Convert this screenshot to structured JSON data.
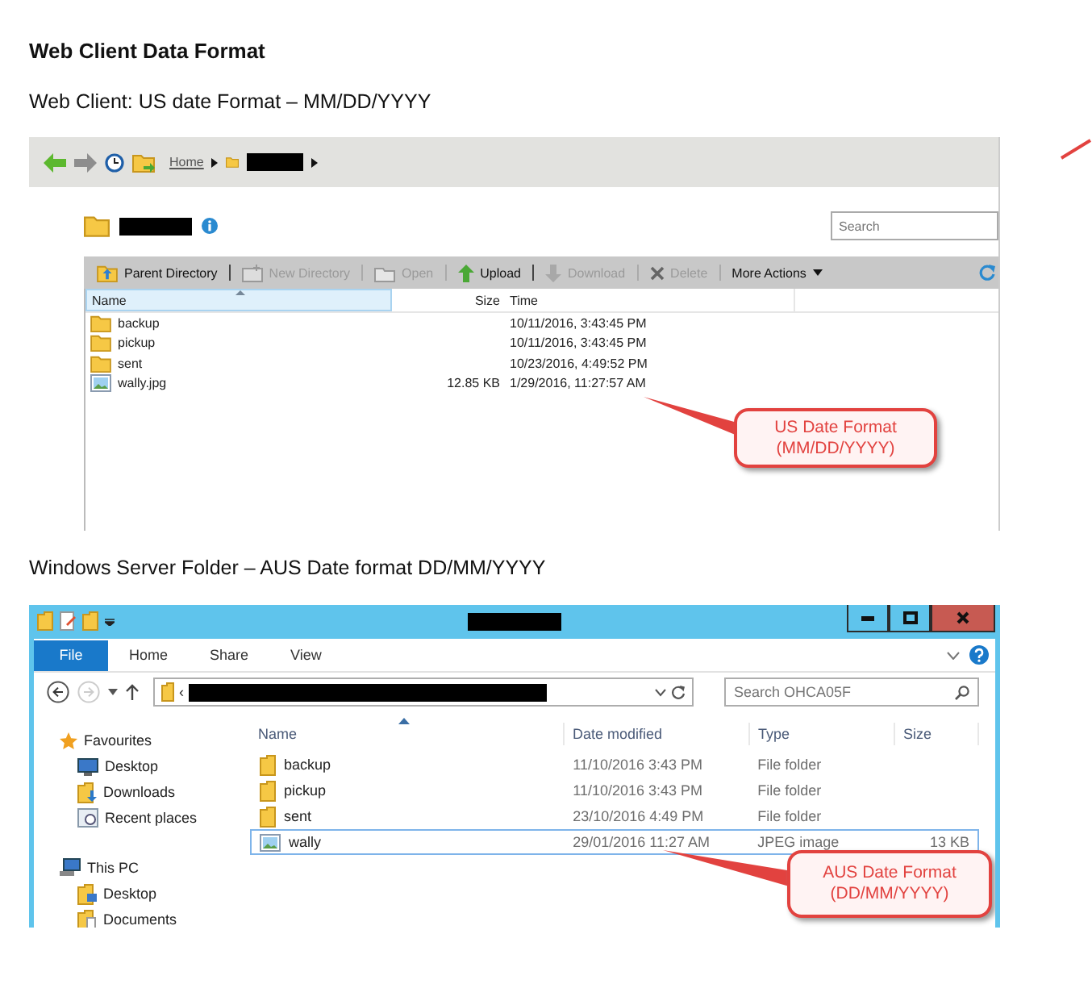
{
  "heading": "Web Client Data Format",
  "web_client_caption": "Web Client: US date Format – MM/DD/YYYY",
  "web_client": {
    "breadcrumb_home": "Home",
    "search": {
      "placeholder": "Search"
    },
    "toolbar": [
      {
        "label": "Parent Directory",
        "kind": "button",
        "disabled": false
      },
      {
        "label": "New Directory",
        "kind": "button",
        "disabled": true
      },
      {
        "label": "Open",
        "kind": "button",
        "disabled": true
      },
      {
        "label": "Upload",
        "kind": "button",
        "disabled": false
      },
      {
        "label": "Download",
        "kind": "button",
        "disabled": true
      },
      {
        "label": "Delete",
        "kind": "button",
        "disabled": true
      },
      {
        "label": "More Actions",
        "kind": "menu",
        "disabled": false
      }
    ],
    "columns": [
      "Name",
      "Size",
      "Time"
    ],
    "rows": [
      {
        "name": "backup",
        "kind": "folder",
        "time": "10/11/2016, 3:43:45 PM"
      },
      {
        "name": "pickup",
        "kind": "folder",
        "time": "10/11/2016, 3:43:45 PM"
      },
      {
        "name": "sent",
        "kind": "folder",
        "time": "10/23/2016, 4:49:52 PM"
      },
      {
        "name": "wally.jpg",
        "kind": "image",
        "size": "12.85 KB",
        "time": "1/29/2016, 11:27:57 AM"
      }
    ],
    "callout": [
      "US Date Format",
      "(MM/DD/YYYY)"
    ]
  },
  "windows_caption": "Windows Server Folder – AUS Date format DD/MM/YYYY",
  "explorer": {
    "ribbon_tabs": [
      {
        "label": "File",
        "kind": "file"
      },
      {
        "label": "Home",
        "kind": "tab"
      },
      {
        "label": "Share",
        "kind": "tab"
      },
      {
        "label": "View",
        "kind": "tab"
      }
    ],
    "address_prefix": "‹",
    "search": {
      "placeholder": "Search OHCA05F"
    },
    "nav": [
      {
        "label": "Favourites",
        "children": [
          {
            "label": "Desktop"
          },
          {
            "label": "Downloads"
          },
          {
            "label": "Recent places"
          }
        ]
      },
      {
        "label": "This PC",
        "children": [
          {
            "label": "Desktop"
          },
          {
            "label": "Documents"
          }
        ]
      }
    ],
    "columns": [
      "Name",
      "Date modified",
      "Type",
      "Size"
    ],
    "rows": [
      {
        "name": "backup",
        "kind": "folder",
        "date": "11/10/2016 3:43 PM",
        "type": "File folder",
        "selected": false
      },
      {
        "name": "pickup",
        "kind": "folder",
        "date": "11/10/2016 3:43 PM",
        "type": "File folder",
        "selected": false
      },
      {
        "name": "sent",
        "kind": "folder",
        "date": "23/10/2016 4:49 PM",
        "type": "File folder",
        "selected": false
      },
      {
        "name": "wally",
        "kind": "image",
        "date": "29/01/2016 11:27 AM",
        "type": "JPEG image",
        "size": "13 KB",
        "selected": true
      }
    ],
    "callout": [
      "AUS Date Format",
      "(DD/MM/YYYY)"
    ]
  }
}
